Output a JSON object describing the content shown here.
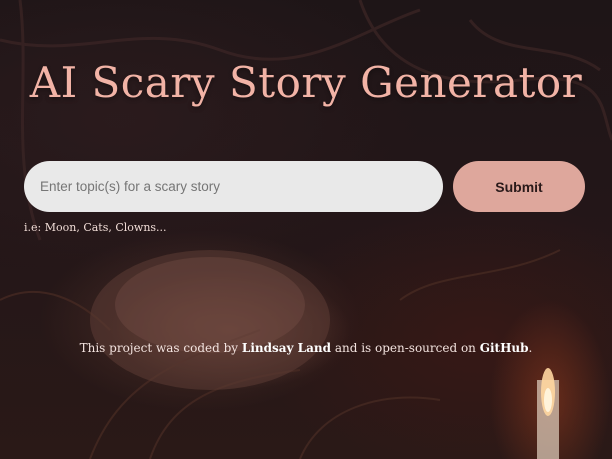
{
  "app": {
    "title": "AI Scary Story Generator"
  },
  "search": {
    "placeholder": "Enter topic(s) for a scary story",
    "value": "",
    "submit_label": "Submit",
    "hint": "i.e: Moon, Cats, Clowns..."
  },
  "footer": {
    "text_before": "This project was coded by ",
    "author": "Lindsay Land",
    "text_middle": " and is open-sourced on ",
    "repo": "GitHub",
    "text_after": "."
  },
  "colors": {
    "title": "#f2b3a6",
    "submit_bg": "#dea79c",
    "input_bg": "#e9e9e9"
  }
}
